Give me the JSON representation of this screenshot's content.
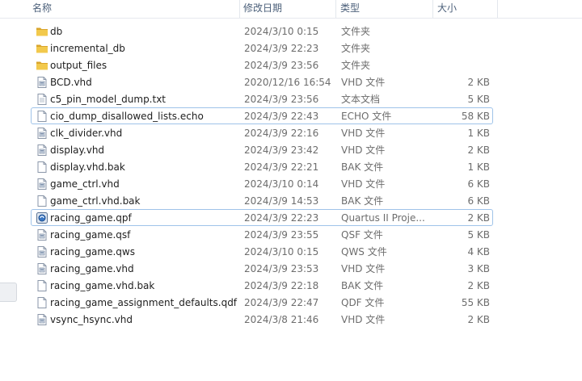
{
  "columns": {
    "name": "名称",
    "date": "修改日期",
    "type": "类型",
    "size": "大小"
  },
  "files": [
    {
      "name": "db",
      "date": "2024/3/10 0:15",
      "type": "文件夹",
      "size": "",
      "icon": "folder-icon",
      "selected": false
    },
    {
      "name": "incremental_db",
      "date": "2024/3/9 22:23",
      "type": "文件夹",
      "size": "",
      "icon": "folder-icon",
      "selected": false
    },
    {
      "name": "output_files",
      "date": "2024/3/9 23:56",
      "type": "文件夹",
      "size": "",
      "icon": "folder-icon",
      "selected": false
    },
    {
      "name": "BCD.vhd",
      "date": "2020/12/16 16:54",
      "type": "VHD 文件",
      "size": "2 KB",
      "icon": "vhd-file-icon",
      "selected": false
    },
    {
      "name": "c5_pin_model_dump.txt",
      "date": "2024/3/9 23:56",
      "type": "文本文档",
      "size": "5 KB",
      "icon": "text-file-icon",
      "selected": false
    },
    {
      "name": "cio_dump_disallowed_lists.echo",
      "date": "2024/3/9 22:43",
      "type": "ECHO 文件",
      "size": "58 KB",
      "icon": "blank-file-icon",
      "selected": true
    },
    {
      "name": "clk_divider.vhd",
      "date": "2024/3/9 22:16",
      "type": "VHD 文件",
      "size": "1 KB",
      "icon": "vhd-file-icon",
      "selected": false
    },
    {
      "name": "display.vhd",
      "date": "2024/3/9 23:42",
      "type": "VHD 文件",
      "size": "2 KB",
      "icon": "vhd-file-icon",
      "selected": false
    },
    {
      "name": "display.vhd.bak",
      "date": "2024/3/9 22:21",
      "type": "BAK 文件",
      "size": "1 KB",
      "icon": "blank-file-icon",
      "selected": false
    },
    {
      "name": "game_ctrl.vhd",
      "date": "2024/3/10 0:14",
      "type": "VHD 文件",
      "size": "6 KB",
      "icon": "vhd-file-icon",
      "selected": false
    },
    {
      "name": "game_ctrl.vhd.bak",
      "date": "2024/3/9 14:53",
      "type": "BAK 文件",
      "size": "6 KB",
      "icon": "blank-file-icon",
      "selected": false
    },
    {
      "name": "racing_game.qpf",
      "date": "2024/3/9 22:23",
      "type": "Quartus II Proje...",
      "size": "2 KB",
      "icon": "quartus-project-icon",
      "selected": true
    },
    {
      "name": "racing_game.qsf",
      "date": "2024/3/9 23:55",
      "type": "QSF 文件",
      "size": "5 KB",
      "icon": "vhd-file-icon",
      "selected": false
    },
    {
      "name": "racing_game.qws",
      "date": "2024/3/10 0:15",
      "type": "QWS 文件",
      "size": "4 KB",
      "icon": "vhd-file-icon",
      "selected": false
    },
    {
      "name": "racing_game.vhd",
      "date": "2024/3/9 23:53",
      "type": "VHD 文件",
      "size": "3 KB",
      "icon": "vhd-file-icon",
      "selected": false
    },
    {
      "name": "racing_game.vhd.bak",
      "date": "2024/3/9 22:18",
      "type": "BAK 文件",
      "size": "2 KB",
      "icon": "blank-file-icon",
      "selected": false
    },
    {
      "name": "racing_game_assignment_defaults.qdf",
      "date": "2024/3/9 22:47",
      "type": "QDF 文件",
      "size": "55 KB",
      "icon": "blank-file-icon",
      "selected": false
    },
    {
      "name": "vsync_hsync.vhd",
      "date": "2024/3/8 21:46",
      "type": "VHD 文件",
      "size": "2 KB",
      "icon": "vhd-file-icon",
      "selected": false
    }
  ],
  "colors": {
    "selection_border": "#9fc3e9",
    "folder": "#e8b93c",
    "header_text": "#4c607a"
  }
}
